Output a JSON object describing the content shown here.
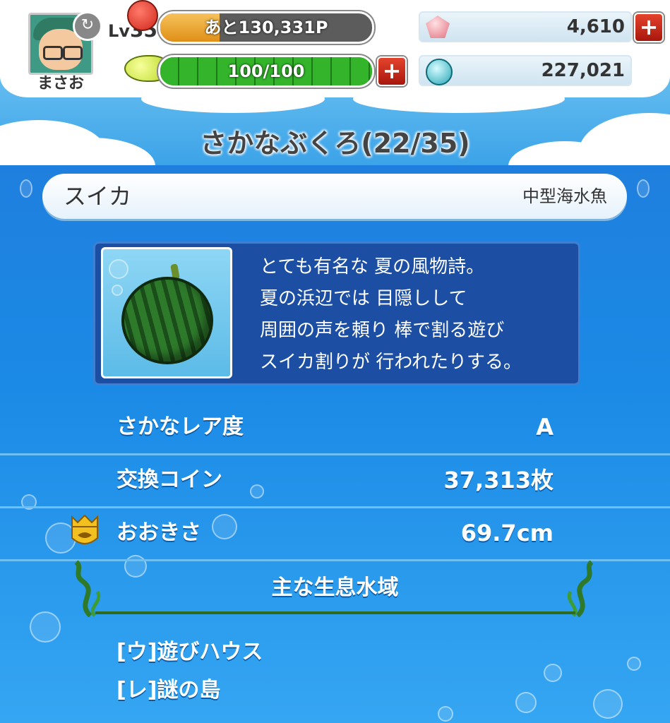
{
  "player": {
    "name": "まさお",
    "level_prefix": "Lv",
    "level": "35",
    "exp_text": "あと130,331P",
    "exp_fraction": 0.28,
    "stamina_text": "100/100",
    "stamina_fraction": 1.0
  },
  "currency": {
    "gems": "4,610",
    "coins": "227,021"
  },
  "page": {
    "title": "さかなぶくろ(22/35)"
  },
  "fish": {
    "name": "スイカ",
    "type": "中型海水魚",
    "description": [
      "とても有名な 夏の風物詩。",
      "夏の浜辺では 目隠しして",
      "周囲の声を頼り 棒で割る遊び",
      "スイカ割りが 行われたりする。"
    ]
  },
  "stats": {
    "rarity_label": "さかなレア度",
    "rarity_value": "A",
    "coins_label": "交換コイン",
    "coins_value": "37,313枚",
    "size_label": "おおきさ",
    "size_value": "69.7cm"
  },
  "habitat": {
    "title": "主な生息水域",
    "locations": [
      "[ウ]遊びハウス",
      "[レ]謎の島"
    ]
  },
  "colors": {
    "water": "#1f8ee3",
    "exp_fill": "#e08f17",
    "stamina_fill": "#33b42b",
    "plus_button": "#d02a1a"
  }
}
